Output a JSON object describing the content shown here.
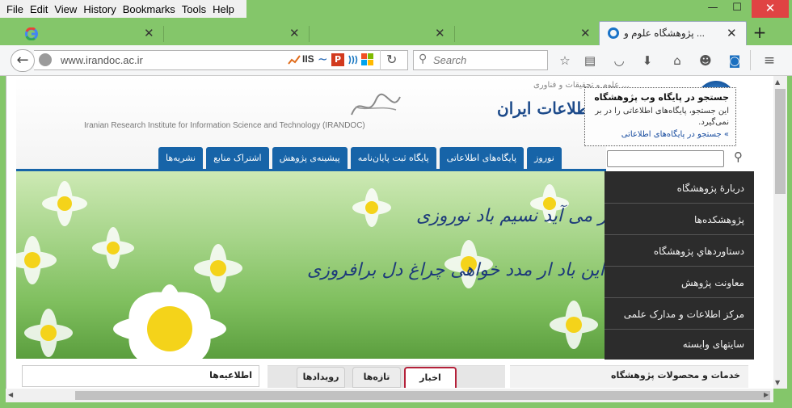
{
  "menubar": [
    "File",
    "Edit",
    "View",
    "History",
    "Bookmarks",
    "Tools",
    "Help"
  ],
  "tabs": [
    {
      "label": "",
      "icon": "google-icon"
    },
    {
      "label": ""
    },
    {
      "label": ""
    },
    {
      "label": "... پژوهشگاه علوم و",
      "active": true
    }
  ],
  "window": {
    "close": "✕",
    "minimize": "—",
    "maximize": "☐"
  },
  "toolbar": {
    "url": "www.irandoc.ac.ir",
    "search_placeholder": "Search",
    "new_tab": "+"
  },
  "site": {
    "logo_title": "... اطلاعات ایران",
    "logo_sub": "... علوم و تحقیقات و فناوری",
    "logo_en": "Iranian Research Institute for Information Science and Technology (IRANDOC)",
    "popup_title": "جستجو در پایگاه وب پژوهشگاه",
    "popup_desc": "این جستجو، پایگاه‌های اطلاعاتی را در بر نمی‌گیرد.",
    "popup_link": "» جستجو در پایگاه‌های اطلاعاتی",
    "nav_tabs": [
      "نوروز",
      "پایگاه‌های اطلاعاتی",
      "پایگاه ثبت پایان‌نامه",
      "پیشینه‌ی پژوهش",
      "اشتراک منابع",
      "نشریه‌ها"
    ],
    "banner_line1": "زکوی یار می آید نسیم باد نوروزی",
    "banner_line2": "از این باد ار مدد خواهی چراغ دل برافروزی",
    "sidebar": [
      "دربارهٔ پژوهشگاه",
      "پژوهشکده‌ها",
      "دستاوردهاي پژوهشگاه",
      "معاونت پژوهش",
      "مرکز اطلاعات و مدارک علمی",
      "سایتهای وابسته"
    ],
    "bottom_left": "اطلاعیه‌ها",
    "bottom_right": "خدمات و محصولات پژوهشگاه",
    "news_tabs": [
      "اخبار",
      "تازه‌ها",
      "رویدادها"
    ]
  },
  "colors": {
    "chrome": "#84c66a",
    "nav": "#1764a8",
    "sidebar": "#2c2c2c",
    "accent": "#b4213a"
  }
}
